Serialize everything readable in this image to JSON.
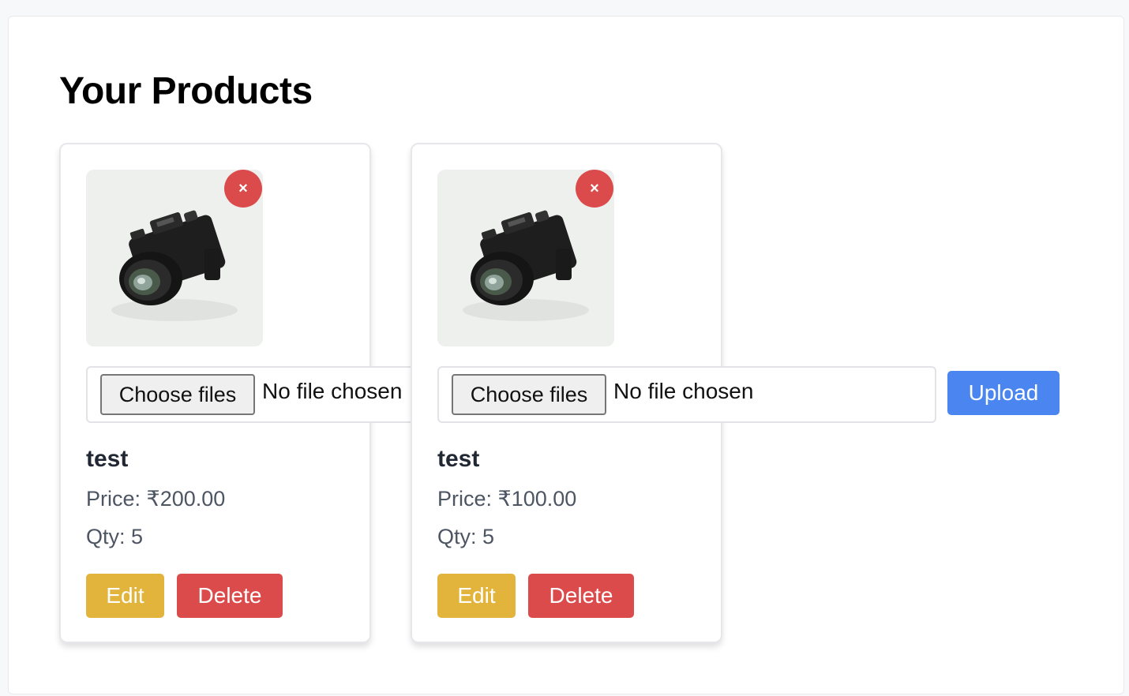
{
  "page": {
    "title": "Your Products"
  },
  "products": [
    {
      "name": "test",
      "price": "Price: ₹200.00",
      "qty": "Qty: 5",
      "remove_symbol": "×",
      "file_input": {
        "button_label": "Choose files",
        "status": "No file chosen"
      },
      "edit_label": "Edit",
      "delete_label": "Delete",
      "image_icon": "camera-image"
    },
    {
      "name": "test",
      "price": "Price: ₹100.00",
      "qty": "Qty: 5",
      "remove_symbol": "×",
      "file_input": {
        "button_label": "Choose files",
        "status": "No file chosen"
      },
      "edit_label": "Edit",
      "delete_label": "Delete",
      "image_icon": "camera-image"
    }
  ],
  "upload_label": "Upload",
  "colors": {
    "upload": "#4a85f0",
    "edit": "#e2b43b",
    "delete": "#dc4b4b",
    "remove": "#dc4b4b"
  }
}
